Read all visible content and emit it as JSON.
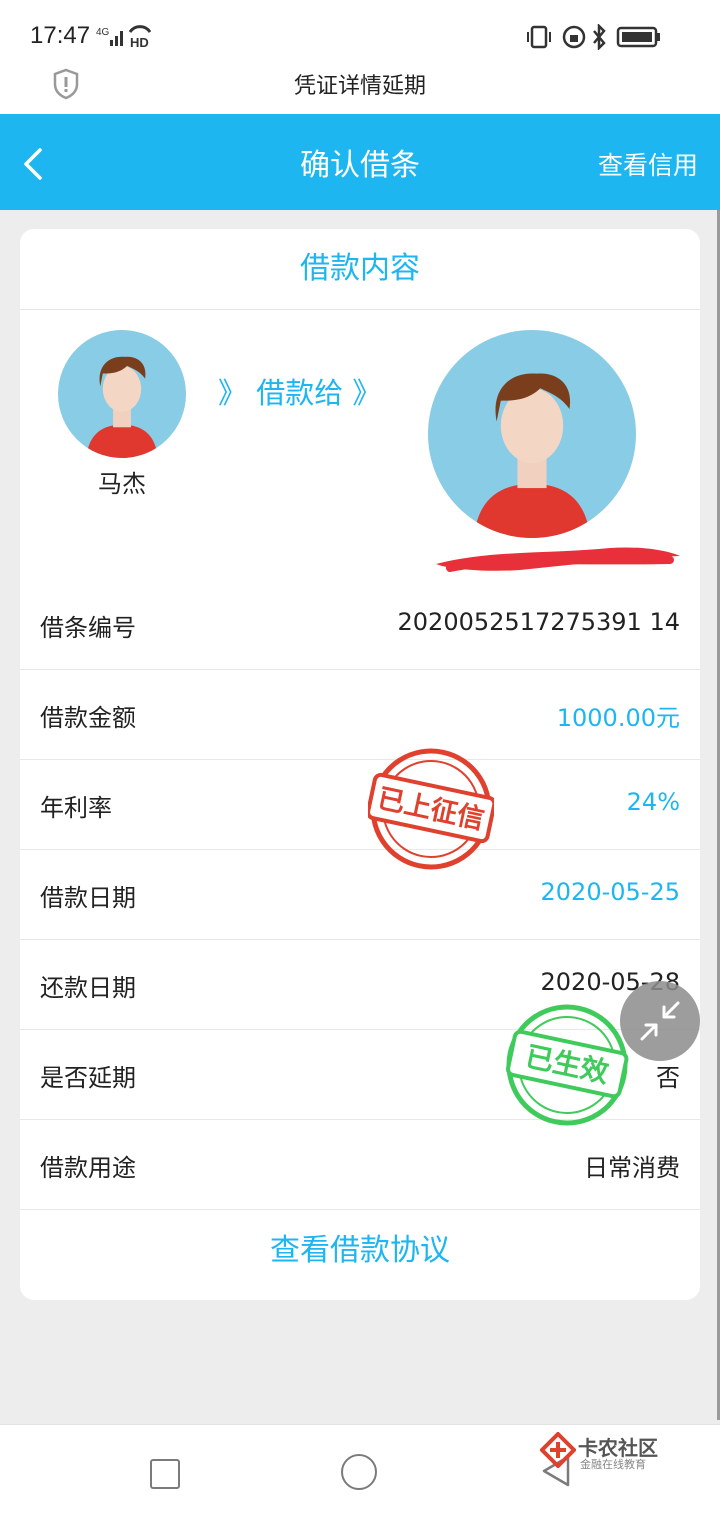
{
  "status_bar": {
    "time": "17:47",
    "network": "4G",
    "hd": "HD"
  },
  "browser": {
    "title": "凭证详情延期"
  },
  "app_bar": {
    "title": "确认借条",
    "right_action": "查看信用"
  },
  "card": {
    "header": "借款内容",
    "borrower_name": "马杰",
    "lend_to_text": "》 借款给 》",
    "rows": [
      {
        "label": "借条编号",
        "value": "2020052517275391 14"
      },
      {
        "label": "借款金额",
        "value": "1000.00元",
        "accent": true
      },
      {
        "label": "年利率",
        "value": "24%",
        "accent": true
      },
      {
        "label": "借款日期",
        "value": "2020-05-25",
        "accent": true
      },
      {
        "label": "还款日期",
        "value": "2020-05-28"
      },
      {
        "label": "是否延期",
        "value": "否"
      },
      {
        "label": "借款用途",
        "value": "日常消费"
      }
    ],
    "agreement_link": "查看借款协议"
  },
  "stamps": {
    "credit": "已上征信",
    "effective": "已生效"
  },
  "watermark": {
    "title": "卡农社区",
    "subtitle": "金融在线教育"
  },
  "colors": {
    "accent": "#1eb6f0",
    "stamp_red": "#e0412f",
    "stamp_green": "#3fcb5b"
  }
}
